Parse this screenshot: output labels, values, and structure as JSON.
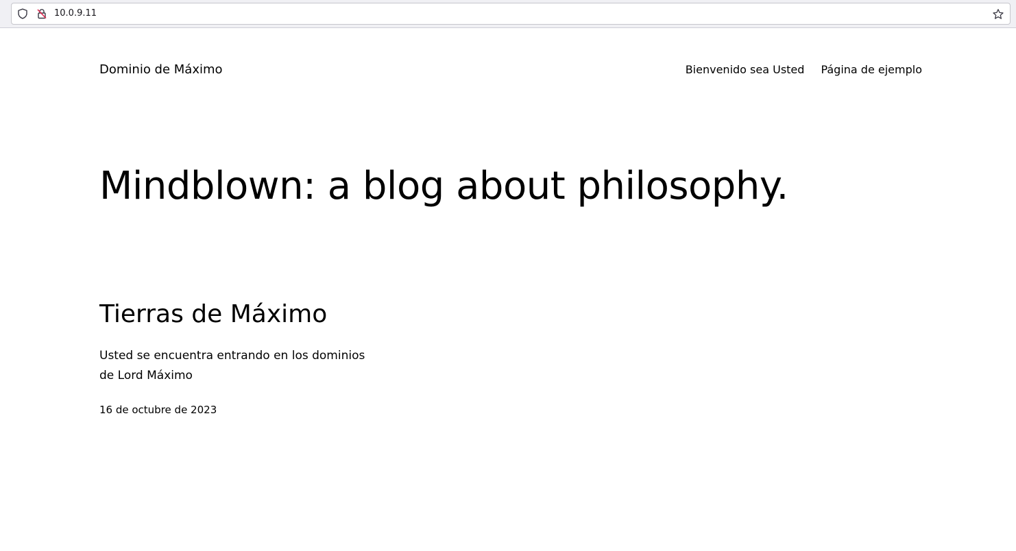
{
  "browser": {
    "url": "10.0.9.11",
    "icons": [
      "shield-icon",
      "insecure-lock-icon",
      "bookmark-star-icon"
    ]
  },
  "site": {
    "title": "Dominio de Máximo",
    "nav": [
      {
        "label": "Bienvenido sea Usted"
      },
      {
        "label": "Página de ejemplo"
      }
    ]
  },
  "hero": {
    "text": "Mindblown: a blog about philosophy."
  },
  "post": {
    "title": "Tierras de Máximo",
    "excerpt": "Usted se encuentra entrando en los dominios de Lord Máximo",
    "date": "16 de octubre de 2023"
  },
  "colors": {
    "text": "#000000",
    "chrome_bg": "#f0f0f4",
    "insecure_accent": "#e22850"
  }
}
